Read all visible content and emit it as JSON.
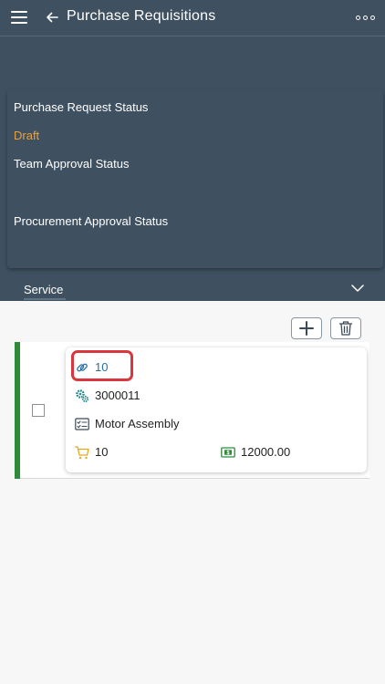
{
  "header": {
    "title": "Purchase Requisitions"
  },
  "status": {
    "purchase_request_label": "Purchase Request Status",
    "purchase_request_value": "Draft",
    "team_approval_label": "Team Approval Status",
    "procurement_approval_label": "Procurement Approval Status"
  },
  "service_tab": {
    "label": "Service"
  },
  "item": {
    "line_number": "10",
    "material_number": "3000011",
    "description": "Motor Assembly",
    "quantity": "10",
    "amount": "12000.00",
    "status_color": "#2e8b3a"
  },
  "colors": {
    "header_bg": "#3f5161",
    "accent_orange": "#e9a23b",
    "link_blue": "#2a6fa6",
    "highlight_red": "#d9363e"
  },
  "icons": {
    "menu": "menu-icon",
    "back": "back-arrow-icon",
    "more": "more-icon",
    "chevron": "chevron-down-icon",
    "add": "add-icon",
    "delete": "trash-icon",
    "line": "link-icon",
    "material": "gears-icon",
    "description": "checklist-icon",
    "quantity": "cart-icon",
    "amount": "money-icon"
  }
}
